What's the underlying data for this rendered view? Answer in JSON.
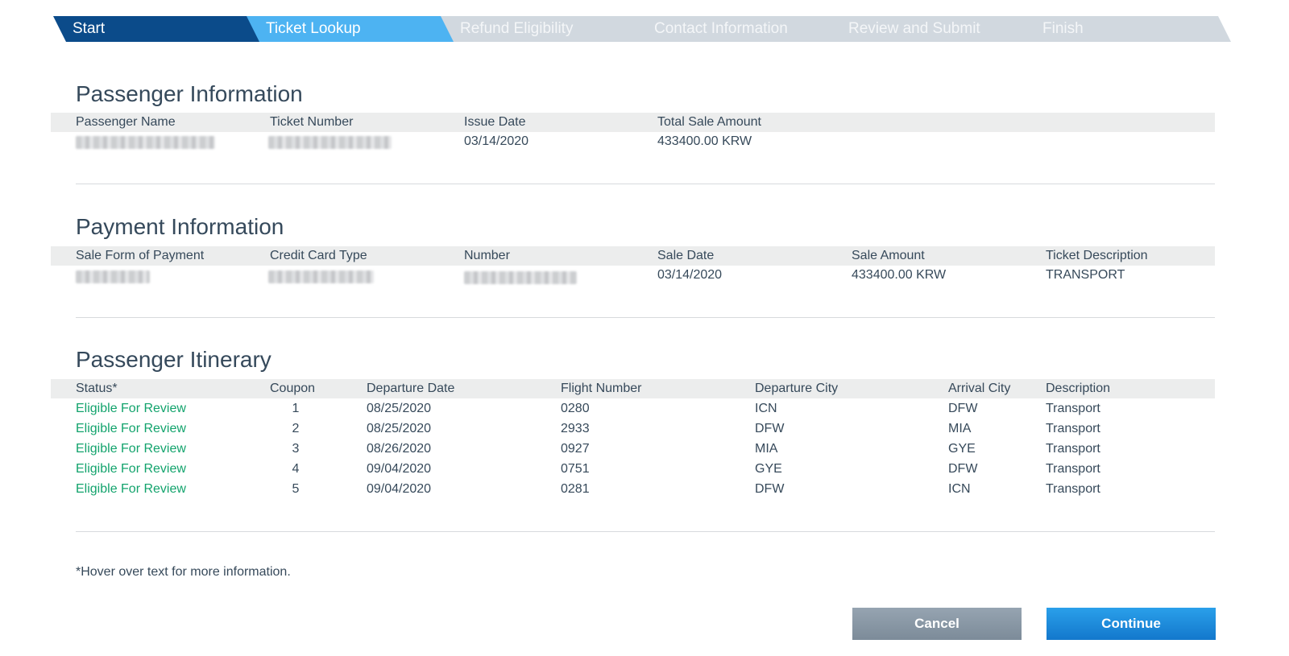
{
  "stepper": {
    "steps": [
      {
        "label": "Start",
        "state": "done"
      },
      {
        "label": "Ticket Lookup",
        "state": "active"
      },
      {
        "label": "Refund Eligibility",
        "state": "pending"
      },
      {
        "label": "Contact Information",
        "state": "pending"
      },
      {
        "label": "Review and Submit",
        "state": "pending"
      },
      {
        "label": "Finish",
        "state": "pending"
      }
    ]
  },
  "passenger_info": {
    "title": "Passenger Information",
    "headers": {
      "name": "Passenger Name",
      "ticket": "Ticket Number",
      "issue_date": "Issue Date",
      "total": "Total Sale Amount"
    },
    "row": {
      "issue_date": "03/14/2020",
      "total": "433400.00 KRW"
    }
  },
  "payment_info": {
    "title": "Payment Information",
    "headers": {
      "form": "Sale Form of Payment",
      "card_type": "Credit Card Type",
      "number": "Number",
      "sale_date": "Sale Date",
      "sale_amount": "Sale Amount",
      "description": "Ticket Description"
    },
    "row": {
      "sale_date": "03/14/2020",
      "sale_amount": "433400.00 KRW",
      "description": "TRANSPORT"
    }
  },
  "itinerary": {
    "title": "Passenger Itinerary",
    "headers": {
      "status": "Status*",
      "coupon": "Coupon",
      "departure_date": "Departure Date",
      "flight": "Flight Number",
      "departure_city": "Departure City",
      "arrival_city": "Arrival City",
      "description": "Description"
    },
    "rows": [
      {
        "status": "Eligible For Review",
        "coupon": "1",
        "departure_date": "08/25/2020",
        "flight": "0280",
        "departure_city": "ICN",
        "arrival_city": "DFW",
        "description": "Transport"
      },
      {
        "status": "Eligible For Review",
        "coupon": "2",
        "departure_date": "08/25/2020",
        "flight": "2933",
        "departure_city": "DFW",
        "arrival_city": "MIA",
        "description": "Transport"
      },
      {
        "status": "Eligible For Review",
        "coupon": "3",
        "departure_date": "08/26/2020",
        "flight": "0927",
        "departure_city": "MIA",
        "arrival_city": "GYE",
        "description": "Transport"
      },
      {
        "status": "Eligible For Review",
        "coupon": "4",
        "departure_date": "09/04/2020",
        "flight": "0751",
        "departure_city": "GYE",
        "arrival_city": "DFW",
        "description": "Transport"
      },
      {
        "status": "Eligible For Review",
        "coupon": "5",
        "departure_date": "09/04/2020",
        "flight": "0281",
        "departure_city": "DFW",
        "arrival_city": "ICN",
        "description": "Transport"
      }
    ]
  },
  "footnote": "*Hover over text for more information.",
  "buttons": {
    "cancel": "Cancel",
    "continue": "Continue"
  },
  "colors": {
    "step_done": "#0b4b8a",
    "step_active": "#4db3f2",
    "step_pending": "#d1d8df",
    "status_green": "#12a36c",
    "continue_blue": "#1a88d8",
    "cancel_gray": "#8896a4"
  }
}
